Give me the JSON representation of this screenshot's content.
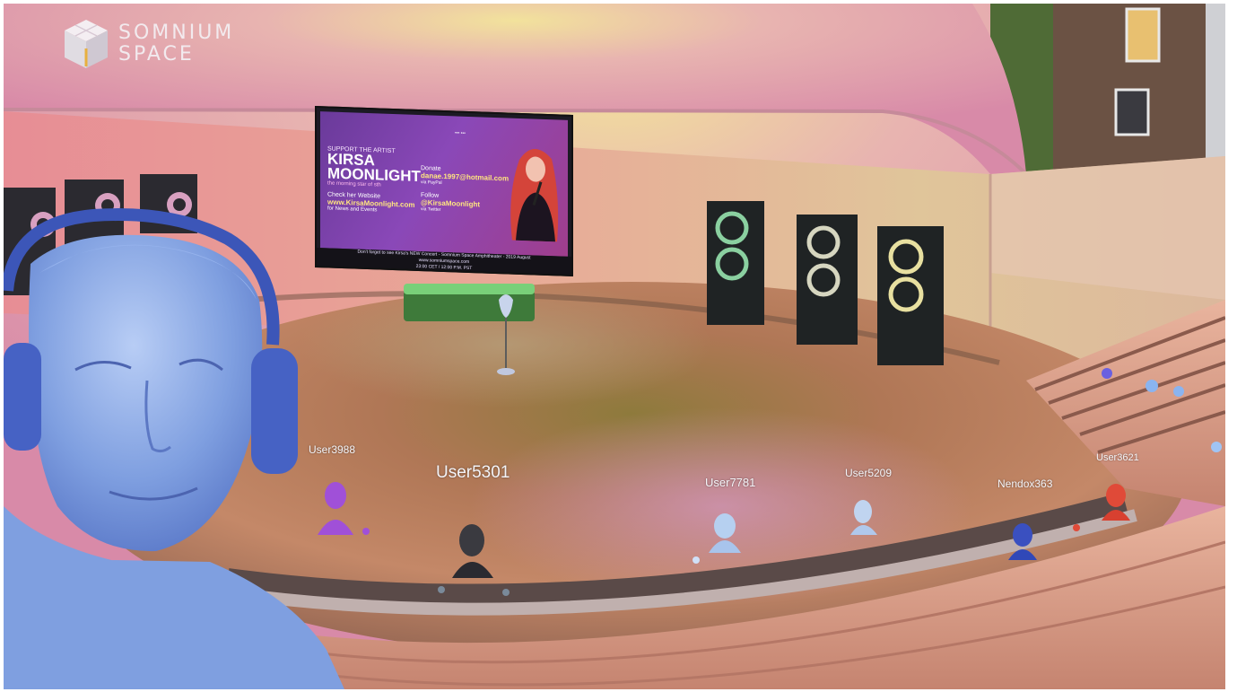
{
  "brand": {
    "name_line1": "SOMNIUM",
    "name_line2": "SPACE",
    "logo_icon": "cube-logo-icon"
  },
  "screen": {
    "support_text": "SUPPORT THE ARTIST",
    "artist_title": "KIRSA MOONLIGHT",
    "subtitle": "the morning star of sth",
    "check_text": "Check her Website",
    "website": "www.KirsaMoonlight.com",
    "website_note": "for News and Events",
    "donate_label": "Donate",
    "donate_email": "danae.1997@hotmail.com",
    "donate_via": "via PayPal",
    "follow_label": "Follow",
    "twitter_handle": "@KirsaMoonlight",
    "twitter_via": "via Twitter",
    "tagline": "••• •••",
    "footer_line1": "Don't forget to see Kirsa's NEW Concert - Somnium Space Amphitheater - 2019 August",
    "footer_line2": "www.somniumspace.com",
    "footer_line3": "23:00 CET / 12:00 P.M. PST"
  },
  "users": [
    {
      "name": "User3988"
    },
    {
      "name": "User5301"
    },
    {
      "name": "User7781"
    },
    {
      "name": "User5209"
    },
    {
      "name": "Nendox363"
    },
    {
      "name": "User3621"
    }
  ],
  "colors": {
    "stage_floor": "#b97a5a",
    "sky": "#e39ab0",
    "avatar_blue": "#7f9fe0",
    "screen_purple": "#8a48b8"
  }
}
